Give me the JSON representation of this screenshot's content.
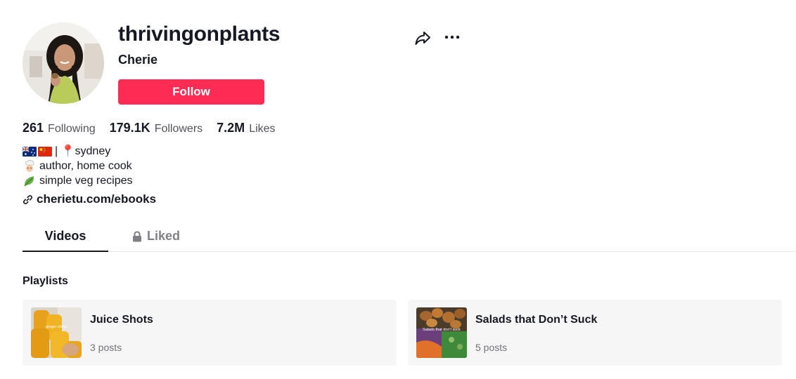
{
  "profile": {
    "username": "thrivingonplants",
    "nickname": "Cherie",
    "follow_label": "Follow"
  },
  "stats": [
    {
      "value": "261",
      "label": "Following"
    },
    {
      "value": "179.1K",
      "label": "Followers"
    },
    {
      "value": "7.2M",
      "label": "Likes"
    }
  ],
  "bio": {
    "line1": "| 📍sydney",
    "line2": "author, home cook",
    "line3": "simple veg recipes",
    "link": "cherietu.com/ebooks"
  },
  "tabs": [
    {
      "label": "Videos",
      "active": true
    },
    {
      "label": "Liked",
      "active": false,
      "locked": true
    }
  ],
  "playlists": {
    "heading": "Playlists",
    "items": [
      {
        "title": "Juice Shots",
        "count": "3 posts",
        "thumb_text": "ginger shots"
      },
      {
        "title": "Salads that Don’t Suck",
        "count": "5 posts",
        "thumb_text": "Salads that don't suck"
      }
    ]
  },
  "colors": {
    "accent": "#fe2c55",
    "text": "#161823",
    "card_bg": "#f6f6f6"
  },
  "icons": [
    "share-icon",
    "more-icon",
    "link-icon",
    "lock-icon",
    "australia-flag-icon",
    "china-flag-icon",
    "cook-emoji-icon",
    "leaf-emoji-icon"
  ]
}
